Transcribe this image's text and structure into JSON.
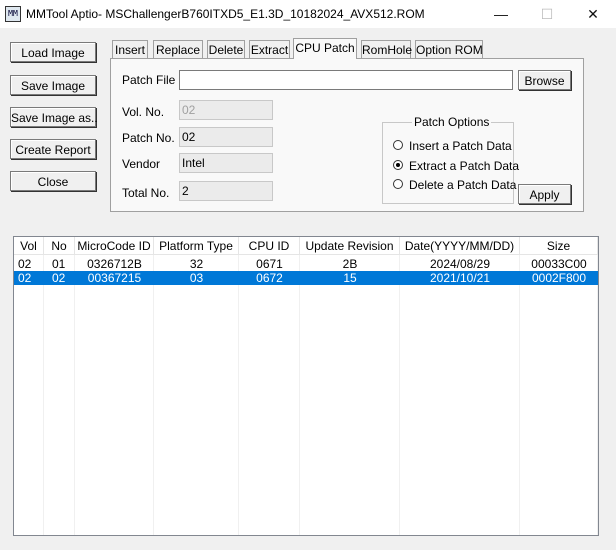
{
  "window": {
    "title": "MMTool Aptio- MSChallengerB760ITXD5_E1.3D_10182024_AVX512.ROM",
    "icon_name": "mm-app-icon",
    "icon_text": "MM",
    "controls": {
      "minimize": "—",
      "maximize": "☐",
      "close": "✕"
    }
  },
  "sidebar": {
    "load_image": "Load Image",
    "save_image": "Save Image",
    "save_image_as": "Save Image as..",
    "create_report": "Create Report",
    "close": "Close"
  },
  "tabs": [
    "Insert",
    "Replace",
    "Delete",
    "Extract",
    "CPU Patch",
    "RomHole",
    "Option ROM"
  ],
  "active_tab": "CPU Patch",
  "cpu_patch": {
    "patch_file_label": "Patch File",
    "patch_file_value": "",
    "browse": "Browse",
    "vol_no_label": "Vol. No.",
    "vol_no_value": "02",
    "patch_no_label": "Patch No.",
    "patch_no_value": "02",
    "vendor_label": "Vendor",
    "vendor_value": "Intel",
    "total_no_label": "Total No.",
    "total_no_value": "2",
    "options_title": "Patch Options",
    "options": [
      "Insert a Patch Data",
      "Extract a Patch Data",
      "Delete a Patch Data"
    ],
    "selected_option": "Extract a Patch Data",
    "apply": "Apply"
  },
  "table": {
    "columns": [
      "Vol",
      "No",
      "MicroCode ID",
      "Platform Type",
      "CPU ID",
      "Update Revision",
      "Date(YYYY/MM/DD)",
      "Size"
    ],
    "rows": [
      [
        "02",
        "01",
        "0326712B",
        "32",
        "0671",
        "2B",
        "2024/08/29",
        "00033C00"
      ],
      [
        "02",
        "02",
        "00367215",
        "03",
        "0672",
        "15",
        "2021/10/21",
        "0002F800"
      ]
    ],
    "selected_row": 1
  },
  "colors": {
    "selection": "#0078d7",
    "window_bg": "#f0f0f0"
  }
}
